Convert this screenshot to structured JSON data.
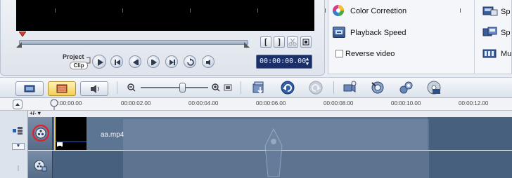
{
  "player": {
    "timecode": "00:00:00.00",
    "project_label": "Project",
    "clip_label": "Clip",
    "trim_buttons": [
      "[",
      "]"
    ]
  },
  "options": {
    "color_correction": "Color Correction",
    "playback_speed": "Playback Speed",
    "reverse_video": "Reverse video",
    "reverse_checked": false,
    "right_items": [
      "Sp",
      "Sp",
      "Mu"
    ]
  },
  "ruler": {
    "ticks": [
      "00:00:00.00",
      "00:00:02.00",
      "00:00:04.00",
      "00:00:06.00",
      "00:00:08.00",
      "00:00:10.00",
      "00:00:12.00"
    ]
  },
  "timeline": {
    "zoom_indicator": "+/-",
    "clip_name": "aa.mp4"
  },
  "colors": {
    "track_bg": "#46607d",
    "timecode_bg": "#1b3068",
    "highlight_ring": "#e0202a",
    "clip_border": "#f3cf3a"
  }
}
